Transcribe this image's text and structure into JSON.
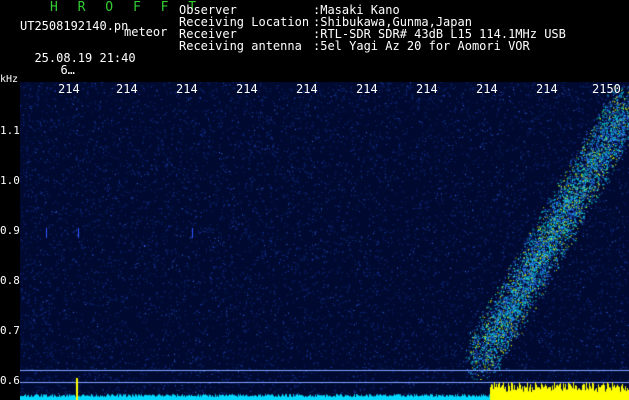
{
  "header": {
    "station_code": "H R O F F T",
    "filename": "UT2508192140.pn",
    "tag": "meteor",
    "datetime": "25.08.19 21:40",
    "counter": "6…",
    "fields": [
      {
        "label": "Observer",
        "value": ":Masaki Kano"
      },
      {
        "label": "Receiving Location",
        "value": ":Shibukawa,Gunma,Japan"
      },
      {
        "label": "Receiver",
        "value": ":RTL-SDR SDR# 43dB L15 114.1MHz USB"
      },
      {
        "label": "Receiving antenna",
        "value": ":5el Yagi Az 20 for Aomori VOR"
      }
    ]
  },
  "spectrogram": {
    "y_unit": "kHz",
    "y_ticks": [
      "1.1",
      "1.0",
      "0.9",
      "0.8",
      "0.7",
      "0.6"
    ],
    "x_ticks": [
      "214",
      "214",
      "214",
      "214",
      "214",
      "214",
      "214",
      "214",
      "214",
      "2150"
    ],
    "colors": {
      "background": "#000a30",
      "noise": "#1a3fd0",
      "signal": "#00e0e0",
      "strong": "#d8ff00",
      "baseline": "#00d8ff",
      "yellow": "#ffff00"
    }
  }
}
